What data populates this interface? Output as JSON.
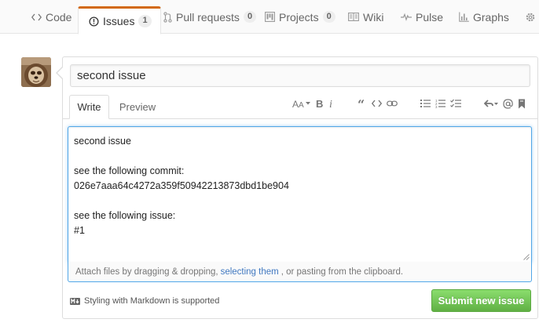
{
  "repo_nav": {
    "tabs": [
      {
        "label": "Code",
        "icon": "code-icon"
      },
      {
        "label": "Issues",
        "icon": "issue-opened-icon",
        "count": "1",
        "selected": true
      },
      {
        "label": "Pull requests",
        "icon": "git-pull-request-icon",
        "count": "0"
      },
      {
        "label": "Projects",
        "icon": "project-icon",
        "count": "0"
      },
      {
        "label": "Wiki",
        "icon": "book-icon"
      },
      {
        "label": "Pulse",
        "icon": "pulse-icon"
      },
      {
        "label": "Graphs",
        "icon": "graph-icon"
      },
      {
        "label": "",
        "icon": "gear-icon"
      }
    ],
    "accent_color": "#d26911"
  },
  "new_issue": {
    "title_value": "second issue",
    "tabs": {
      "write": "Write",
      "preview": "Preview"
    },
    "toolbar": [
      "text-size-icon",
      "bold-icon",
      "italic-icon",
      "quote-icon",
      "code-icon",
      "link-icon",
      "unordered-list-icon",
      "ordered-list-icon",
      "task-list-icon",
      "reply-icon",
      "mention-icon",
      "bookmark-icon"
    ],
    "body_lines": [
      "second issue",
      "",
      "see the following commit:",
      "026e7aaa64c4272a359f50942213873dbd1be904",
      "",
      "see the following issue:",
      "#1"
    ],
    "attach": {
      "prefix": "Attach files by dragging & dropping,",
      "link": "selecting them",
      "suffix": ", or pasting from the clipboard."
    },
    "markdown_hint": "Styling with Markdown is supported",
    "submit_label": "Submit new issue",
    "submit_color": "#60b044",
    "focus_color": "#51a7e8"
  }
}
